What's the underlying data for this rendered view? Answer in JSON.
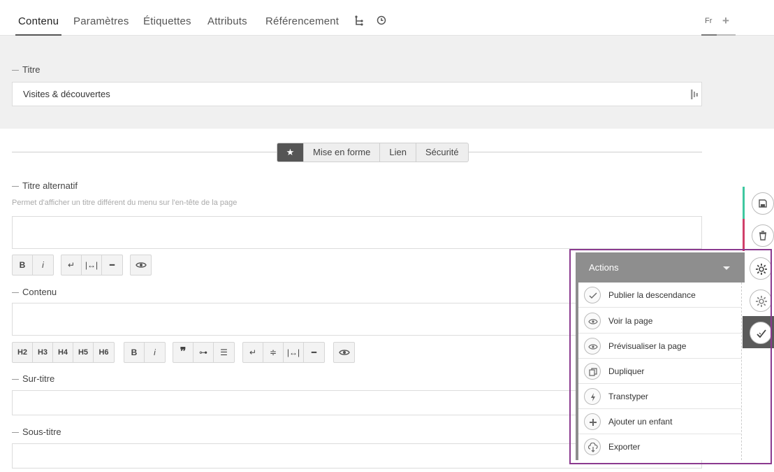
{
  "tabs": [
    {
      "label": "Contenu"
    },
    {
      "label": "Paramètres"
    },
    {
      "label": "Étiquettes"
    },
    {
      "label": "Attributs"
    },
    {
      "label": "Référencement"
    }
  ],
  "tab_icons": [
    "tree-icon",
    "history-clock-icon"
  ],
  "language": {
    "code": "Fr",
    "add_icon": "plus-icon"
  },
  "title_field": {
    "label": "Titre",
    "value": "Visites & découvertes",
    "icon": "field-handle-icon"
  },
  "segments": {
    "star_icon": "star-icon",
    "items": [
      "Mise en forme",
      "Lien",
      "Sécurité"
    ]
  },
  "alt_title": {
    "label": "Titre alternatif",
    "hint": "Permet d'afficher un titre différent du menu sur l'en-tête de la page"
  },
  "alt_toolbar": [
    "B",
    "i",
    "return-icon",
    "nbsp-icon",
    "hr-icon",
    "preview-eye-icon"
  ],
  "content_field": {
    "label": "Contenu"
  },
  "content_toolbar": [
    "H2",
    "H3",
    "H4",
    "H5",
    "H6",
    "B",
    "i",
    "quote-icon",
    "link-icon",
    "list-icon",
    "return-icon",
    "strike-icon",
    "nbsp-icon",
    "hr-icon",
    "preview-eye-icon"
  ],
  "surtitle": {
    "label": "Sur-titre"
  },
  "subtitle": {
    "label": "Sous-titre"
  },
  "rail_icons": [
    "save-icon",
    "trash-icon",
    "gear-icon",
    "gear-icon",
    "publish-check-icon"
  ],
  "actions": {
    "title": "Actions",
    "items": [
      {
        "label": "Publier la descendance",
        "icon": "publish-check-icon"
      },
      {
        "label": "Voir la page",
        "icon": "eye-icon"
      },
      {
        "label": "Prévisualiser la page",
        "icon": "eye-icon"
      },
      {
        "label": "Dupliquer",
        "icon": "duplicate-icon"
      },
      {
        "label": "Transtyper",
        "icon": "lightning-icon"
      },
      {
        "label": "Ajouter un enfant",
        "icon": "plus-icon"
      },
      {
        "label": "Exporter",
        "icon": "cloud-download-icon"
      }
    ]
  },
  "colors": {
    "save_accent": "#3fc7a0",
    "delete_accent": "#d0406a",
    "highlight": "#8b3a8f"
  }
}
